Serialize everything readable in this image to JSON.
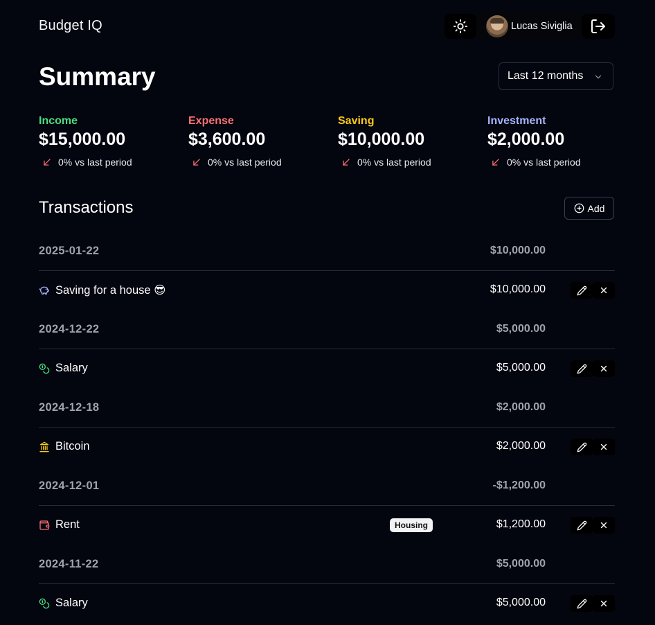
{
  "app": {
    "title": "Budget IQ"
  },
  "user": {
    "name": "Lucas Siviglia"
  },
  "summary": {
    "title": "Summary",
    "period": "Last 12 months",
    "stats": [
      {
        "label": "Income",
        "value": "$15,000.00",
        "change": "0% vs last period",
        "color": "#4ade80"
      },
      {
        "label": "Expense",
        "value": "$3,600.00",
        "change": "0% vs last period",
        "color": "#f87171"
      },
      {
        "label": "Saving",
        "value": "$10,000.00",
        "change": "0% vs last period",
        "color": "#facc15"
      },
      {
        "label": "Investment",
        "value": "$2,000.00",
        "change": "0% vs last period",
        "color": "#a5b4fc"
      }
    ]
  },
  "transactions": {
    "title": "Transactions",
    "add_label": "Add",
    "groups": [
      {
        "date": "2025-01-22",
        "total": "$10,000.00",
        "items": [
          {
            "name": "Saving for a house 😎",
            "amount": "$10,000.00",
            "icon": "piggy-bank-icon",
            "tag": ""
          }
        ]
      },
      {
        "date": "2024-12-22",
        "total": "$5,000.00",
        "items": [
          {
            "name": "Salary",
            "amount": "$5,000.00",
            "icon": "coins-icon",
            "tag": ""
          }
        ]
      },
      {
        "date": "2024-12-18",
        "total": "$2,000.00",
        "items": [
          {
            "name": "Bitcoin",
            "amount": "$2,000.00",
            "icon": "bank-icon",
            "tag": ""
          }
        ]
      },
      {
        "date": "2024-12-01",
        "total": "-$1,200.00",
        "items": [
          {
            "name": "Rent",
            "amount": "$1,200.00",
            "icon": "wallet-icon",
            "tag": "Housing"
          }
        ]
      },
      {
        "date": "2024-11-22",
        "total": "$5,000.00",
        "items": [
          {
            "name": "Salary",
            "amount": "$5,000.00",
            "icon": "coins-icon",
            "tag": ""
          }
        ]
      }
    ]
  },
  "colors": {
    "background": "#03050f",
    "income": "#4ade80",
    "expense": "#f87171",
    "saving": "#facc15",
    "investment": "#a5b4fc",
    "trend_down": "#f87171"
  }
}
